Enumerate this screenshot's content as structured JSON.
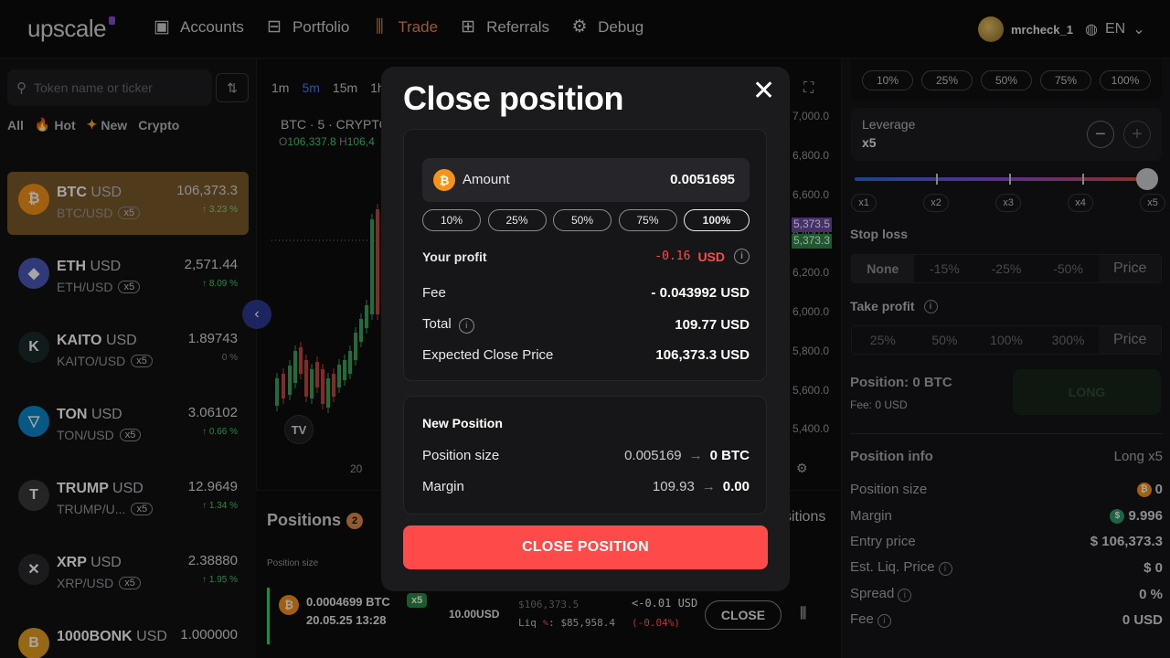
{
  "brand": {
    "logo_text": "upscale"
  },
  "nav": {
    "items": [
      {
        "label": "Accounts"
      },
      {
        "label": "Portfolio"
      },
      {
        "label": "Trade"
      },
      {
        "label": "Referrals"
      },
      {
        "label": "Debug"
      }
    ],
    "user_name": "mrcheck_1",
    "language": "EN"
  },
  "sidebar": {
    "search_placeholder": "Token name or ticker",
    "filters": [
      "All",
      "Hot",
      "New",
      "Crypto"
    ],
    "tokens": [
      {
        "symbol": "BTC",
        "quote": "USD",
        "pair": "BTC/USD",
        "leverage": "x5",
        "price": "106,373.3",
        "change": "↑ 3.23 %",
        "icon_color": "#f7931a",
        "glyph": "₿"
      },
      {
        "symbol": "ETH",
        "quote": "USD",
        "pair": "ETH/USD",
        "leverage": "x5",
        "price": "2,571.44",
        "change": "↑ 8.09 %",
        "icon_color": "#4a5ab8",
        "glyph": "◆"
      },
      {
        "symbol": "KAITO",
        "quote": "USD",
        "pair": "KAITO/USD",
        "leverage": "x5",
        "price": "1.89743",
        "change": "0 %",
        "icon_color": "#1c2a2a",
        "glyph": "K"
      },
      {
        "symbol": "TON",
        "quote": "USD",
        "pair": "TON/USD",
        "leverage": "x5",
        "price": "3.06102",
        "change": "↑ 0.66 %",
        "icon_color": "#0a88cc",
        "glyph": "▽"
      },
      {
        "symbol": "TRUMP",
        "quote": "USD",
        "pair": "TRUMP/U...",
        "leverage": "x5",
        "price": "12.9649",
        "change": "↑ 1.34 %",
        "icon_color": "#3a3a3a",
        "glyph": "T"
      },
      {
        "symbol": "XRP",
        "quote": "USD",
        "pair": "XRP/USD",
        "leverage": "x5",
        "price": "2.38880",
        "change": "↑ 1.95 %",
        "icon_color": "#2a2a2e",
        "glyph": "✕"
      },
      {
        "symbol": "1000BONK",
        "quote": "USD",
        "pair": "",
        "leverage": "",
        "price": "1.000000",
        "change": "",
        "icon_color": "#e8a020",
        "glyph": "B"
      }
    ]
  },
  "chart": {
    "intervals": [
      "1m",
      "5m",
      "15m",
      "1h"
    ],
    "active_interval": "5m",
    "symbol_line": "BTC · 5 · CRYPTO",
    "ohlc_open_label": "O",
    "ohlc_open": "106,337.8",
    "ohlc_high_label": "H",
    "ohlc_high": "106,4",
    "y_ticks": [
      "7,000.0",
      "6,800.0",
      "6,600.0",
      "6,400.0",
      "6,200.0",
      "6,000.0",
      "5,800.0",
      "5,600.0",
      "5,400.0"
    ],
    "tag_purple": "5,373.5",
    "tag_green": "5,373.3",
    "x_tick": "20",
    "tv_logo": "TV"
  },
  "positions": {
    "tab_label": "Positions",
    "tab_count": "2",
    "tab2_label": "sitions",
    "col_header": "Position size",
    "row": {
      "size": "0.0004699 BTC",
      "date": "20.05.25 13:28",
      "leverage": "x5",
      "margin": "10.00USD",
      "entry": "$106,373.5",
      "liq_label": "Liq",
      "liq": ": $85,958.4",
      "pnl": "<-0.01 USD",
      "pnl_pct": "(-0.04%)",
      "close_label": "CLOSE"
    }
  },
  "right_panel": {
    "pcts": [
      "10%",
      "25%",
      "50%",
      "75%",
      "100%"
    ],
    "leverage_label": "Leverage",
    "leverage_value": "x5",
    "lev_minus": "−",
    "lev_plus": "+",
    "slider_value": 5,
    "slider_max": 5,
    "slider_labels": [
      "x1",
      "x2",
      "x3",
      "x4",
      "x5"
    ],
    "stop_loss_label": "Stop loss",
    "stop_loss_options": [
      "None",
      "-15%",
      "-25%",
      "-50%",
      "Price"
    ],
    "take_profit_label": "Take profit",
    "take_profit_options": [
      "25%",
      "50%",
      "100%",
      "300%",
      "Price"
    ],
    "position_label": "Position: 0 BTC",
    "fee_label": "Fee: 0 USD",
    "long_label": "LONG",
    "info_title": "Position info",
    "info_sub": "Long x5",
    "info": [
      {
        "k": "Position size",
        "v": "0"
      },
      {
        "k": "Margin",
        "v": "9.996"
      },
      {
        "k": "Entry price",
        "v": "$ 106,373.3"
      },
      {
        "k": "Est. Liq. Price",
        "v": "$ 0"
      },
      {
        "k": "Spread",
        "v": "0 %"
      },
      {
        "k": "Fee",
        "v": "0 USD"
      }
    ]
  },
  "modal": {
    "title": "Close position",
    "amount_label": "Amount",
    "amount_value": "0.0051695",
    "pcts": [
      "10%",
      "25%",
      "50%",
      "75%",
      "100%"
    ],
    "active_pct": "100%",
    "profit_label": "Your profit",
    "profit_value": "-0.16",
    "profit_unit": "USD",
    "fee_label": "Fee",
    "fee_value": "- 0.043992 USD",
    "total_label": "Total",
    "total_value": "109.77 USD",
    "ecp_label": "Expected Close Price",
    "ecp_value": "106,373.3 USD",
    "new_position_title": "New Position",
    "pos_size_label": "Position size",
    "pos_size_from": "0.005169",
    "pos_size_to": "0 BTC",
    "margin_label": "Margin",
    "margin_from": "109.93",
    "margin_to": "0.00",
    "close_button": "CLOSE POSITION"
  },
  "colors": {
    "accent": "#e28a4a",
    "danger": "#ff4a4a",
    "positive": "#3ccf6a",
    "btc": "#f7931a"
  }
}
